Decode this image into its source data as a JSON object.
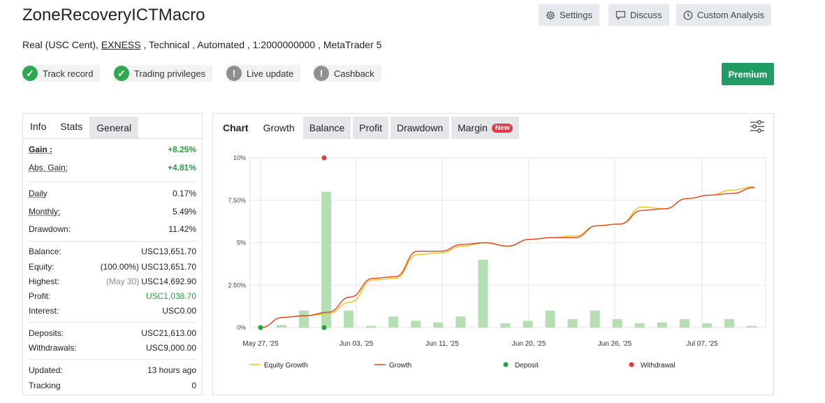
{
  "header": {
    "title": "ZoneRecoveryICTMacro",
    "subtitle_pre": "Real (USC Cent), ",
    "broker": "EXNESS",
    "subtitle_post": " , Technical , Automated , 1:2000000000 , MetaTrader 5",
    "buttons": {
      "settings": "Settings",
      "discuss": "Discuss",
      "custom_analysis": "Custom Analysis"
    },
    "premium": "Premium"
  },
  "badges": [
    {
      "label": "Track record",
      "status": "ok"
    },
    {
      "label": "Trading privileges",
      "status": "ok"
    },
    {
      "label": "Live update",
      "status": "warn"
    },
    {
      "label": "Cashback",
      "status": "warn"
    }
  ],
  "left_tabs": [
    "Info",
    "Stats",
    "General"
  ],
  "stats": {
    "gain": {
      "label": "Gain :",
      "value": "+8.25%"
    },
    "abs_gain": {
      "label": "Abs. Gain:",
      "value": "+4.81%"
    },
    "daily": {
      "label": "Daily",
      "value": "0.17%"
    },
    "monthly": {
      "label": "Monthly:",
      "value": "5.49%"
    },
    "drawdown": {
      "label": "Drawdown:",
      "value": "11.42%"
    },
    "balance": {
      "label": "Balance:",
      "value": "USC13,651.70"
    },
    "equity": {
      "label": "Equity:",
      "value": "(100.00%) USC13,651.70"
    },
    "highest": {
      "label": "Highest:",
      "note": "(May 30)",
      "value": "USC14,692.90"
    },
    "profit": {
      "label": "Profit:",
      "value": "USC1,038.70"
    },
    "interest": {
      "label": "Interest:",
      "value": "USC0.00"
    },
    "deposits": {
      "label": "Deposits:",
      "value": "USC21,613.00"
    },
    "withdrawals": {
      "label": "Withdrawals:",
      "value": "USC9,000.00"
    },
    "updated": {
      "label": "Updated:",
      "value": "13 hours ago"
    },
    "tracking": {
      "label": "Tracking",
      "value": "0"
    }
  },
  "chart_tabs": {
    "chart": "Chart",
    "growth": "Growth",
    "balance": "Balance",
    "profit": "Profit",
    "drawdown": "Drawdown",
    "margin": "Margin",
    "new": "New"
  },
  "colors": {
    "equity": "#f2c21b",
    "growth": "#e8431f",
    "bars": "#b5dfb3",
    "deposit": "#1ea53a",
    "withdrawal": "#e53935",
    "premium": "#1f9d63"
  },
  "chart_data": {
    "type": "line",
    "ylim": [
      0,
      10
    ],
    "yticks": [
      "0%",
      "2.50%",
      "5%",
      "7.50%",
      "10%"
    ],
    "xticks": [
      "May 27, '25",
      "Jun 03, '25",
      "Jun 11, '25",
      "Jun 20, '25",
      "Jun 26, '25",
      "Jul 07, '25"
    ],
    "bars": [
      0.15,
      1.0,
      8.0,
      1.0,
      0.1,
      0.65,
      0.4,
      0.3,
      0.65,
      4.0,
      0.25,
      0.4,
      1.0,
      0.5,
      1.0,
      0.5,
      0.25,
      0.3,
      0.5,
      0.25,
      0.5,
      0.1
    ],
    "series": [
      {
        "name": "Equity Growth",
        "values": [
          0,
          0.6,
          0.7,
          0.8,
          1.5,
          2.8,
          2.9,
          4.3,
          4.4,
          4.8,
          5.0,
          4.8,
          5.2,
          5.3,
          5.4,
          6.0,
          6.1,
          7.1,
          7.0,
          7.6,
          7.8,
          8.1,
          8.3
        ]
      },
      {
        "name": "Growth",
        "values": [
          0,
          0.6,
          0.7,
          0.9,
          1.8,
          2.9,
          3.0,
          4.5,
          4.5,
          4.9,
          5.0,
          4.8,
          5.2,
          5.3,
          5.3,
          6.0,
          6.1,
          6.9,
          7.0,
          7.6,
          7.8,
          7.9,
          8.25
        ]
      }
    ],
    "deposit_points": [
      0,
      0
    ],
    "withdrawal_points": [
      10
    ],
    "legend": [
      "Equity Growth",
      "Growth",
      "Deposit",
      "Withdrawal"
    ]
  }
}
